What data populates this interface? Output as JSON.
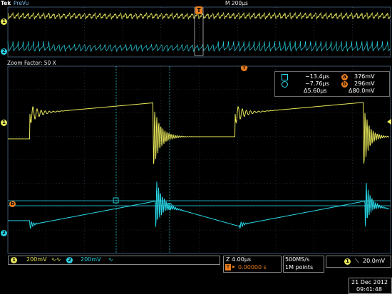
{
  "header": {
    "logo": "Tek",
    "mode": "PreVu",
    "timebase": "M 200µs"
  },
  "trigger_marker": "T",
  "zoom": {
    "label": "Zoom Factor: 50 X"
  },
  "channels": [
    {
      "id": "1",
      "color": "#e8e85a"
    },
    {
      "id": "2",
      "color": "#29d6e6"
    }
  ],
  "ref_marker": "b",
  "cursor_readout": {
    "c1_time": "−13.4µs",
    "c2_time": "−7.76µs",
    "delta_time": "Δ5.60µs",
    "a_label": "a",
    "a_value": "376mV",
    "b_label": "b",
    "b_value": "296mV",
    "delta_value": "Δ80.0mV"
  },
  "bottom": {
    "ch1_scale": "200mV",
    "ch1_coupling": "∿∿",
    "ch2_scale": "200mV",
    "ch2_coupling": "∿",
    "zoom_time": "Z 4.00µs",
    "trigger_pos": "0.00000 s",
    "sample_rate": "500MS/s",
    "record_length": "1M points",
    "trig_source": "1",
    "trig_slope": "⟍",
    "trig_level": "20.0mV",
    "date": "21 Dec 2012",
    "time": "09:41:48"
  },
  "colors": {
    "ch1": "#e8e85a",
    "ch2": "#29d6e6",
    "orange": "#e87d1e",
    "grid": "#34506a"
  }
}
